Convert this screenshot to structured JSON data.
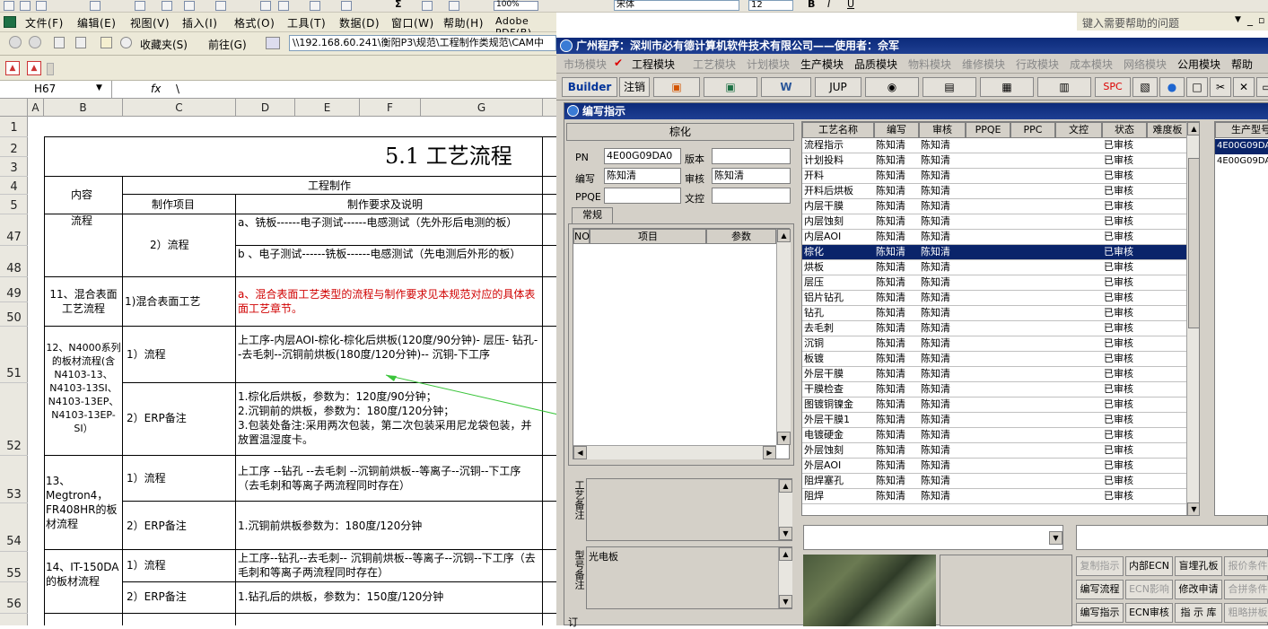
{
  "excel": {
    "menu": [
      "文件(F)",
      "编辑(E)",
      "视图(V)",
      "插入(I)",
      "格式(O)",
      "工具(T)",
      "数据(D)",
      "窗口(W)",
      "帮助(H)",
      "Adobe PDF(B)"
    ],
    "help_placeholder": "键入需要帮助的问题",
    "font_name": "宋体",
    "font_size": "12",
    "zoom": "100%",
    "favorites": "收藏夹(S)",
    "goto": "前往(G)",
    "path": "\\\\192.168.60.241\\衡阳P3\\规范\\工程制作类规范\\CAM中",
    "name_box": "H67",
    "fx": "fx",
    "formula_value": "\\",
    "columns": [
      "A",
      "B",
      "C",
      "D",
      "E",
      "F",
      "G"
    ],
    "rows": [
      "1",
      "2",
      "3",
      "4",
      "5",
      "47",
      "48",
      "49",
      "50",
      "51",
      "52",
      "53",
      "54",
      "55",
      "56"
    ],
    "sheet": {
      "title": "5.1  工艺流程",
      "col_content": "内容",
      "col_engineering": "工程制作",
      "col_item": "制作项目",
      "col_requirement": "制作要求及说明",
      "r_flow_label": "流程",
      "r_flow_item": "2）流程",
      "r_flow_a": "a、铣板------电子测试------电感测试（先外形后电测的板）",
      "r_flow_b": "b 、电子测试------铣板------电感测试（先电测后外形的板）",
      "r_mix_label": "11、混合表面工艺流程",
      "r_mix_item": "1)混合表面工艺",
      "r_mix_text": "a、混合表面工艺类型的流程与制作要求见本规范对应的具体表面工艺章节。",
      "r_n4000_label": "12、N4000系列的板材流程(含N4103-13、N4103-13SI、N4103-13EP、N4103-13EP-SI）",
      "r_n4000_item1": "1）流程",
      "r_n4000_text1": "上工序-内层AOI-棕化-棕化后烘板(120度/90分钟)- 层压- 钻孔--去毛刺--沉铜前烘板(180度/120分钟)-- 沉铜-下工序",
      "r_n4000_item2": "2）ERP备注",
      "r_n4000_text2a": "1.棕化后烘板，参数为：120度/90分钟；",
      "r_n4000_text2b": "2.沉铜前的烘板，参数为：180度/120分钟；",
      "r_n4000_text2c": "3.包装处备注:采用两次包装，第二次包装采用尼龙袋包装，并放置温湿度卡。",
      "r_meg_label": "13、Megtron4，FR408HR的板材流程",
      "r_meg_item1": "1）流程",
      "r_meg_text1": "上工序 --钻孔 --去毛刺 --沉铜前烘板--等离子--沉铜--下工序（去毛刺和等离子两流程同时存在）",
      "r_meg_item2": "2）ERP备注",
      "r_meg_text2": "1.沉铜前烘板参数为：180度/120分钟",
      "r_it_label": "14、IT-150DA的板材流程",
      "r_it_item1": "1）流程",
      "r_it_text1": "上工序--钻孔--去毛刺-- 沉铜前烘板--等离子--沉铜--下工序（去毛刺和等离子两流程同时存在）",
      "r_it_item2": "2）ERP备注",
      "r_it_text2": "1.钻孔后的烘板，参数为：150度/120分钟"
    }
  },
  "app": {
    "title": "广州程序：深圳市必有德计算机软件技术有限公司——使用者：佘军",
    "menu": [
      "市场模块",
      "工程模块",
      "工艺模块",
      "计划模块",
      "生产模块",
      "品质模块",
      "物料模块",
      "维修模块",
      "行政模块",
      "成本模块",
      "网络模块",
      "公用模块",
      "帮助"
    ],
    "menu_active": [
      false,
      true,
      false,
      false,
      true,
      true,
      false,
      false,
      false,
      false,
      false,
      true,
      true
    ],
    "toolbar_builder": "Builder",
    "toolbar_logout": "注销",
    "toolbar_jup": "JUP",
    "toolbar_spc": "SPC",
    "subwindow_title": "编写指示",
    "process_name": "棕化",
    "fields": {
      "pn_label": "PN",
      "pn_value": "4E00G09DA0",
      "version_label": "版本",
      "version_value": "",
      "author_label": "编写",
      "author_value": "陈知清",
      "reviewer_label": "审核",
      "reviewer_value": "陈知清",
      "ppqe_label": "PPQE",
      "ppqe_value": "",
      "doc_label": "文控",
      "doc_value": ""
    },
    "tab_general": "常规",
    "param_cols": [
      "NO",
      "项目",
      "参数"
    ],
    "process_note_label": "工艺备注",
    "model_note_label": "型号备注",
    "model_note_value": "光电板",
    "order_label": "订",
    "grid_cols": [
      "工艺名称",
      "编写",
      "审核",
      "PPQE",
      "PPC",
      "文控",
      "状态",
      "难度板"
    ],
    "grid_rows": [
      [
        "流程指示",
        "陈知清",
        "陈知清",
        "已审核"
      ],
      [
        "计划投料",
        "陈知清",
        "陈知清",
        "已审核"
      ],
      [
        "开料",
        "陈知清",
        "陈知清",
        "已审核"
      ],
      [
        "开料后烘板",
        "陈知清",
        "陈知清",
        "已审核"
      ],
      [
        "内层干膜",
        "陈知清",
        "陈知清",
        "已审核"
      ],
      [
        "内层蚀刻",
        "陈知清",
        "陈知清",
        "已审核"
      ],
      [
        "内层AOI",
        "陈知清",
        "陈知清",
        "已审核"
      ],
      [
        "棕化",
        "陈知清",
        "陈知清",
        "已审核"
      ],
      [
        "烘板",
        "陈知清",
        "陈知清",
        "已审核"
      ],
      [
        "层压",
        "陈知清",
        "陈知清",
        "已审核"
      ],
      [
        "铝片钻孔",
        "陈知清",
        "陈知清",
        "已审核"
      ],
      [
        "钻孔",
        "陈知清",
        "陈知清",
        "已审核"
      ],
      [
        "去毛刺",
        "陈知清",
        "陈知清",
        "已审核"
      ],
      [
        "沉铜",
        "陈知清",
        "陈知清",
        "已审核"
      ],
      [
        "板镀",
        "陈知清",
        "陈知清",
        "已审核"
      ],
      [
        "外层干膜",
        "陈知清",
        "陈知清",
        "已审核"
      ],
      [
        "干膜检查",
        "陈知清",
        "陈知清",
        "已审核"
      ],
      [
        "图镀铜镍金",
        "陈知清",
        "陈知清",
        "已审核"
      ],
      [
        "外层干膜1",
        "陈知清",
        "陈知清",
        "已审核"
      ],
      [
        "电镀硬金",
        "陈知清",
        "陈知清",
        "已审核"
      ],
      [
        "外层蚀刻",
        "陈知清",
        "陈知清",
        "已审核"
      ],
      [
        "外层AOI",
        "陈知清",
        "陈知清",
        "已审核"
      ],
      [
        "阻焊塞孔",
        "陈知清",
        "陈知清",
        "已审核"
      ],
      [
        "阻焊",
        "陈知清",
        "陈知清",
        "已审核"
      ]
    ],
    "selected_row": 7,
    "model_col_header": "生产型号",
    "model_list": [
      "4E00G09DA0",
      "4E00G09DA0"
    ],
    "action_buttons": [
      {
        "label": "复制指示",
        "enabled": false
      },
      {
        "label": "内部ECN",
        "enabled": true
      },
      {
        "label": "盲埋孔板",
        "enabled": true
      },
      {
        "label": "报价条件",
        "enabled": false
      },
      {
        "label": "编写流程",
        "enabled": true
      },
      {
        "label": "ECN影响",
        "enabled": false
      },
      {
        "label": "修改申请",
        "enabled": true
      },
      {
        "label": "合拼条件",
        "enabled": false
      },
      {
        "label": "编写指示",
        "enabled": true
      },
      {
        "label": "ECN审核",
        "enabled": true
      },
      {
        "label": "指 示 库",
        "enabled": true
      },
      {
        "label": "粗略拼板",
        "enabled": false
      }
    ]
  }
}
